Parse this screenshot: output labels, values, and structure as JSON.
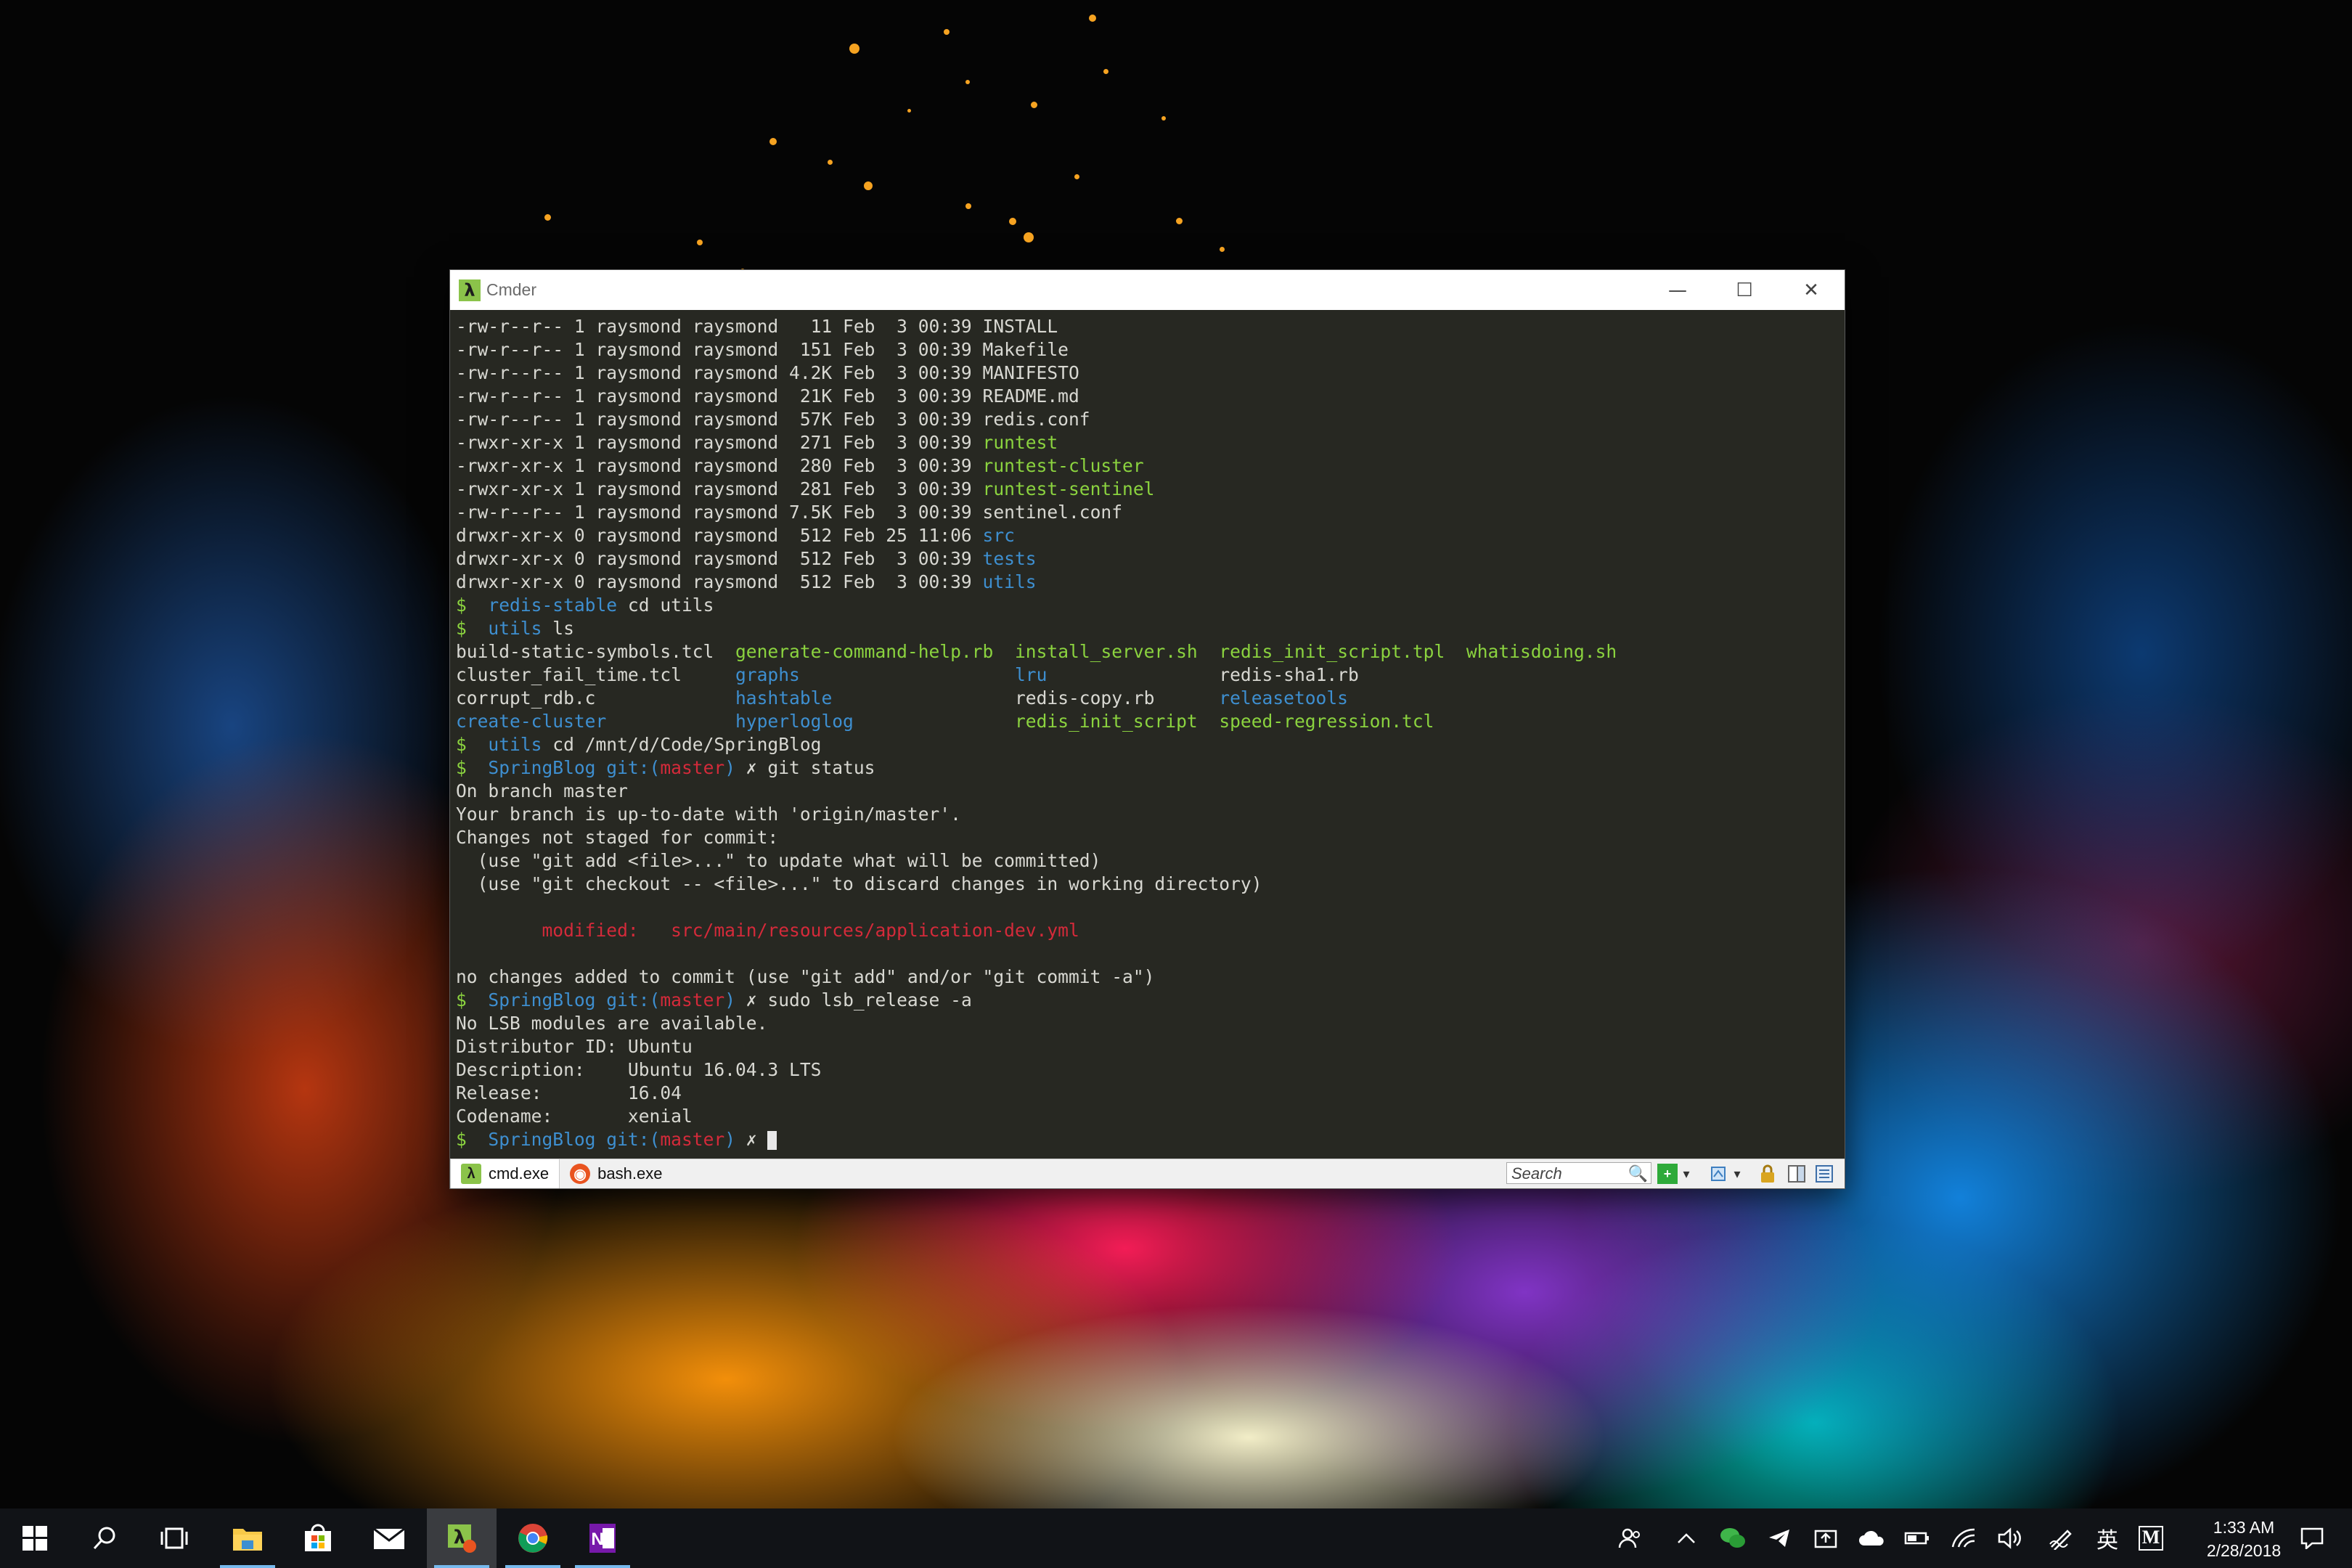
{
  "window": {
    "title": "Cmder",
    "app_icon": "λ",
    "controls": {
      "minimize": "—",
      "maximize": "☐",
      "close": "✕"
    }
  },
  "console": {
    "lines": [
      [
        {
          "t": "-rw-r--r-- 1 raysmond raysmond   11 Feb  3 00:39 INSTALL",
          "c": ""
        }
      ],
      [
        {
          "t": "-rw-r--r-- 1 raysmond raysmond  151 Feb  3 00:39 Makefile",
          "c": ""
        }
      ],
      [
        {
          "t": "-rw-r--r-- 1 raysmond raysmond 4.2K Feb  3 00:39 MANIFESTO",
          "c": ""
        }
      ],
      [
        {
          "t": "-rw-r--r-- 1 raysmond raysmond  21K Feb  3 00:39 README.md",
          "c": ""
        }
      ],
      [
        {
          "t": "-rw-r--r-- 1 raysmond raysmond  57K Feb  3 00:39 redis.conf",
          "c": ""
        }
      ],
      [
        {
          "t": "-rwxr-xr-x 1 raysmond raysmond  271 Feb  3 00:39 ",
          "c": ""
        },
        {
          "t": "runtest",
          "c": "green"
        }
      ],
      [
        {
          "t": "-rwxr-xr-x 1 raysmond raysmond  280 Feb  3 00:39 ",
          "c": ""
        },
        {
          "t": "runtest-cluster",
          "c": "green"
        }
      ],
      [
        {
          "t": "-rwxr-xr-x 1 raysmond raysmond  281 Feb  3 00:39 ",
          "c": ""
        },
        {
          "t": "runtest-sentinel",
          "c": "green"
        }
      ],
      [
        {
          "t": "-rw-r--r-- 1 raysmond raysmond 7.5K Feb  3 00:39 sentinel.conf",
          "c": ""
        }
      ],
      [
        {
          "t": "drwxr-xr-x 0 raysmond raysmond  512 Feb 25 11:06 ",
          "c": ""
        },
        {
          "t": "src",
          "c": "blue"
        }
      ],
      [
        {
          "t": "drwxr-xr-x 0 raysmond raysmond  512 Feb  3 00:39 ",
          "c": ""
        },
        {
          "t": "tests",
          "c": "blue"
        }
      ],
      [
        {
          "t": "drwxr-xr-x 0 raysmond raysmond  512 Feb  3 00:39 ",
          "c": ""
        },
        {
          "t": "utils",
          "c": "blue"
        }
      ],
      [
        {
          "t": "$  ",
          "c": "green"
        },
        {
          "t": "redis-stable",
          "c": "blue"
        },
        {
          "t": " cd utils",
          "c": ""
        }
      ],
      [
        {
          "t": "$  ",
          "c": "green"
        },
        {
          "t": "utils",
          "c": "blue"
        },
        {
          "t": " ls",
          "c": ""
        }
      ],
      [
        {
          "t": "build-static-symbols.tcl  ",
          "c": ""
        },
        {
          "t": "generate-command-help.rb",
          "c": "green"
        },
        {
          "t": "  ",
          "c": ""
        },
        {
          "t": "install_server.sh",
          "c": "green"
        },
        {
          "t": "  ",
          "c": ""
        },
        {
          "t": "redis_init_script.tpl",
          "c": "green"
        },
        {
          "t": "  ",
          "c": ""
        },
        {
          "t": "whatisdoing.sh",
          "c": "green"
        }
      ],
      [
        {
          "t": "cluster_fail_time.tcl     ",
          "c": ""
        },
        {
          "t": "graphs",
          "c": "blue"
        },
        {
          "t": "                    ",
          "c": ""
        },
        {
          "t": "lru",
          "c": "blue"
        },
        {
          "t": "                ",
          "c": ""
        },
        {
          "t": "redis-sha1.rb",
          "c": ""
        }
      ],
      [
        {
          "t": "corrupt_rdb.c             ",
          "c": ""
        },
        {
          "t": "hashtable",
          "c": "blue"
        },
        {
          "t": "                 redis-copy.rb      ",
          "c": ""
        },
        {
          "t": "releasetools",
          "c": "blue"
        }
      ],
      [
        {
          "t": "create-cluster",
          "c": "blue"
        },
        {
          "t": "            ",
          "c": ""
        },
        {
          "t": "hyperloglog",
          "c": "blue"
        },
        {
          "t": "               ",
          "c": ""
        },
        {
          "t": "redis_init_script",
          "c": "green"
        },
        {
          "t": "  ",
          "c": ""
        },
        {
          "t": "speed-regression.tcl",
          "c": "green"
        }
      ],
      [
        {
          "t": "$  ",
          "c": "green"
        },
        {
          "t": "utils",
          "c": "blue"
        },
        {
          "t": " cd /mnt/d/Code/SpringBlog",
          "c": ""
        }
      ],
      [
        {
          "t": "$  ",
          "c": "green"
        },
        {
          "t": "SpringBlog",
          "c": "blue"
        },
        {
          "t": " git:(",
          "c": "blue"
        },
        {
          "t": "master",
          "c": "red"
        },
        {
          "t": ")",
          "c": "blue"
        },
        {
          "t": " ✗ git status",
          "c": ""
        }
      ],
      [
        {
          "t": "On branch master",
          "c": ""
        }
      ],
      [
        {
          "t": "Your branch is up-to-date with 'origin/master'.",
          "c": ""
        }
      ],
      [
        {
          "t": "Changes not staged for commit:",
          "c": ""
        }
      ],
      [
        {
          "t": "  (use \"git add <file>...\" to update what will be committed)",
          "c": ""
        }
      ],
      [
        {
          "t": "  (use \"git checkout -- <file>...\" to discard changes in working directory)",
          "c": ""
        }
      ],
      [
        {
          "t": "",
          "c": ""
        }
      ],
      [
        {
          "t": "        modified:   src/main/resources/application-dev.yml",
          "c": "red"
        }
      ],
      [
        {
          "t": "",
          "c": ""
        }
      ],
      [
        {
          "t": "no changes added to commit (use \"git add\" and/or \"git commit -a\")",
          "c": ""
        }
      ],
      [
        {
          "t": "$  ",
          "c": "green"
        },
        {
          "t": "SpringBlog",
          "c": "blue"
        },
        {
          "t": " git:(",
          "c": "blue"
        },
        {
          "t": "master",
          "c": "red"
        },
        {
          "t": ")",
          "c": "blue"
        },
        {
          "t": " ✗ sudo lsb_release -a",
          "c": ""
        }
      ],
      [
        {
          "t": "No LSB modules are available.",
          "c": ""
        }
      ],
      [
        {
          "t": "Distributor ID: Ubuntu",
          "c": ""
        }
      ],
      [
        {
          "t": "Description:    Ubuntu 16.04.3 LTS",
          "c": ""
        }
      ],
      [
        {
          "t": "Release:        16.04",
          "c": ""
        }
      ],
      [
        {
          "t": "Codename:       xenial",
          "c": ""
        }
      ],
      [
        {
          "t": "$  ",
          "c": "green"
        },
        {
          "t": "SpringBlog",
          "c": "blue"
        },
        {
          "t": " git:(",
          "c": "blue"
        },
        {
          "t": "master",
          "c": "red"
        },
        {
          "t": ")",
          "c": "blue"
        },
        {
          "t": " ✗ ",
          "c": ""
        }
      ]
    ]
  },
  "tabs": [
    {
      "label": "cmd.exe",
      "icon": "lambda-icon",
      "icon_glyph": "λ",
      "active": true
    },
    {
      "label": "bash.exe",
      "icon": "ubuntu-icon",
      "icon_glyph": "◉",
      "active": false
    }
  ],
  "toolbar": {
    "search_placeholder": "Search",
    "search_icon": "🔍",
    "new_tab_icon": "+",
    "dropdown_icon": "▾",
    "lock_icon": "🔒"
  },
  "taskbar": {
    "clock_time": "1:33 AM",
    "clock_date": "2/28/2018",
    "ime_indicator": "英",
    "m_indicator": "M"
  },
  "colors": {
    "green": "#8bd33f",
    "blue": "#3e8fd0",
    "red": "#d42a3a",
    "console_bg": "#272822",
    "taskbar_bg": "#111317"
  }
}
